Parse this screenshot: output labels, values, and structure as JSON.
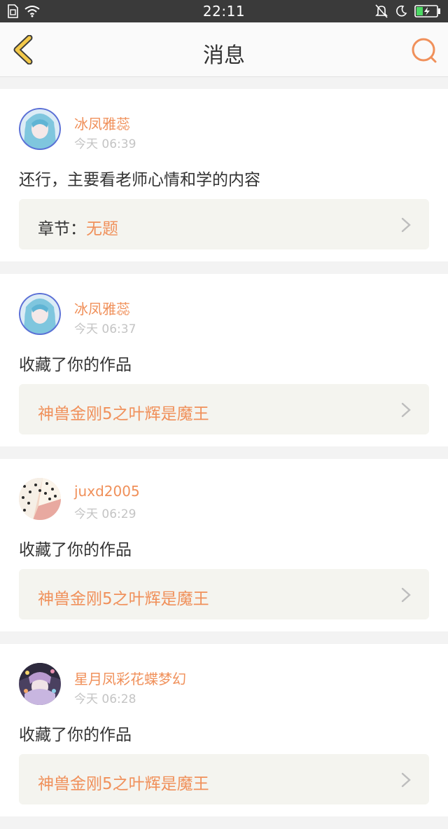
{
  "status_bar": {
    "time": "22:11"
  },
  "navbar": {
    "title": "消息"
  },
  "colors": {
    "accent": "#f0905a",
    "back_arrow": "#f3c94a",
    "status_bar_bg": "#3a3a3a",
    "battery": "#4cd964"
  },
  "messages": [
    {
      "user": "冰凤雅蕊",
      "time": "今天 06:39",
      "content": "还行，主要看老师心情和学的内容",
      "link_prefix": "章节：",
      "link_title": "无题"
    },
    {
      "user": "冰凤雅蕊",
      "time": "今天 06:37",
      "content": "收藏了你的作品",
      "link_prefix": "",
      "link_title": "神兽金刚5之叶辉是魔王"
    },
    {
      "user": "juxd2005",
      "time": "今天 06:29",
      "content": "收藏了你的作品",
      "link_prefix": "",
      "link_title": "神兽金刚5之叶辉是魔王"
    },
    {
      "user": "星月凤彩花蝶梦幻",
      "time": "今天 06:28",
      "content": "收藏了你的作品",
      "link_prefix": "",
      "link_title": "神兽金刚5之叶辉是魔王"
    }
  ]
}
